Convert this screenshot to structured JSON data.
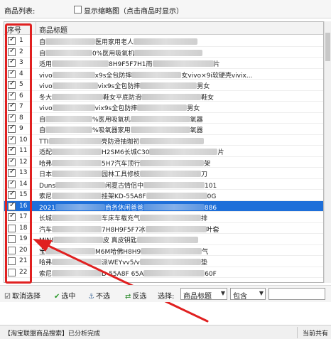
{
  "header": {
    "list_label": "商品列表:",
    "thumbnail_label": "显示缩略图（点击商品时显示）"
  },
  "grid": {
    "columns": {
      "index": "序号",
      "title": "商品标题"
    },
    "rows": [
      {
        "n": "1",
        "checked": true,
        "selected": false,
        "p1": "自",
        "p2": "医用家用老人",
        "p3": ""
      },
      {
        "n": "2",
        "checked": true,
        "selected": false,
        "p1": "自",
        "p2": "0%医用吸氧机",
        "p3": ""
      },
      {
        "n": "3",
        "checked": true,
        "selected": false,
        "p1": "适用",
        "p2": "8H9F5F7H1雨",
        "p3": "片"
      },
      {
        "n": "4",
        "checked": true,
        "selected": false,
        "p1": "vivo",
        "p2": "x9s全包防摔",
        "p3": "女vivo×9i软硬壳vivix..."
      },
      {
        "n": "5",
        "checked": true,
        "selected": false,
        "p1": "vivo",
        "p2": "vix9s全包防摔",
        "p3": "男女"
      },
      {
        "n": "6",
        "checked": true,
        "selected": false,
        "p1": "冬大",
        "p2": "鞋女平底防滑",
        "p3": "鞋女"
      },
      {
        "n": "7",
        "checked": true,
        "selected": false,
        "p1": "vivo",
        "p2": "vix9s全包防摔",
        "p3": "男女"
      },
      {
        "n": "8",
        "checked": true,
        "selected": false,
        "p1": "自",
        "p2": "%医用吸氧机",
        "p3": "氧器"
      },
      {
        "n": "9",
        "checked": true,
        "selected": false,
        "p1": "自",
        "p2": "%吸氧器家用",
        "p3": "氧器"
      },
      {
        "n": "10",
        "checked": true,
        "selected": false,
        "p1": "TTI",
        "p2": "亮防滑抽珈初",
        "p3": ""
      },
      {
        "n": "11",
        "checked": true,
        "selected": false,
        "p1": "适配",
        "p2": "H2SM6长城C30",
        "p3": "片"
      },
      {
        "n": "12",
        "checked": true,
        "selected": false,
        "p1": "哈弗",
        "p2": "5H7汽车顶行",
        "p3": "架"
      },
      {
        "n": "13",
        "checked": true,
        "selected": false,
        "p1": "日本",
        "p2": "园林工具修枝",
        "p3": "刀"
      },
      {
        "n": "14",
        "checked": true,
        "selected": false,
        "p1": "Duns",
        "p2": "闲夏古情侣中",
        "p3": "101"
      },
      {
        "n": "15",
        "checked": true,
        "selected": false,
        "p1": "索尼",
        "p2": "挂架KD-55A8F",
        "p3": "0G"
      },
      {
        "n": "16",
        "checked": true,
        "selected": true,
        "p1": "2021",
        "p2": "商务休闲爸爸",
        "p3": "886"
      },
      {
        "n": "17",
        "checked": true,
        "selected": false,
        "p1": "长城",
        "p2": "车床车载充气",
        "p3": "排"
      },
      {
        "n": "18",
        "checked": false,
        "selected": false,
        "p1": "汽车",
        "p2": "7H8H9F5F7冰",
        "p3": "叶套"
      },
      {
        "n": "19",
        "checked": false,
        "selected": false,
        "p1": "MINI",
        "p2": "皮 真皮钥匙",
        "p3": ""
      },
      {
        "n": "20",
        "checked": false,
        "selected": false,
        "p1": "宝",
        "p2": "M6M哈佛H8H9",
        "p3": "气"
      },
      {
        "n": "21",
        "checked": false,
        "selected": false,
        "p1": "哈弗",
        "p2": "派WEYvv5/v",
        "p3": "垫"
      },
      {
        "n": "22",
        "checked": false,
        "selected": false,
        "p1": "索尼",
        "p2": "D-55A8F 65A",
        "p3": "60F"
      }
    ]
  },
  "toolbar": {
    "cancel_label": "取消选择",
    "select_label": "选中",
    "unselect_label": "不选",
    "invert_label": "反选",
    "choose_label": "选择:",
    "field_value": "商品标题",
    "mode_value": "包含",
    "filter_value": ""
  },
  "statusbar": {
    "left_text": "【淘宝联盟商品搜索】已分析完成",
    "right_text": "当前共有"
  },
  "colors": {
    "annotation_red": "#e02020",
    "selection_blue": "#1e6fd9"
  }
}
